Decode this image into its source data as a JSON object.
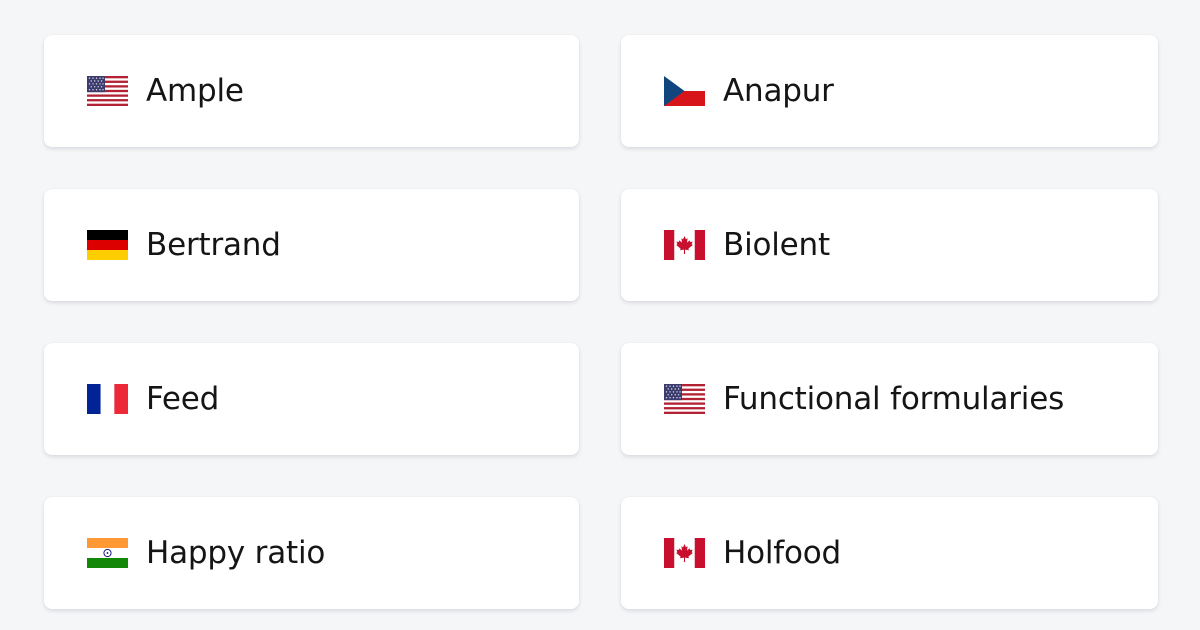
{
  "items": [
    {
      "label": "Ample",
      "flag": "us-flag-icon"
    },
    {
      "label": "Anapur",
      "flag": "czech-flag-icon"
    },
    {
      "label": "Bertrand",
      "flag": "germany-flag-icon"
    },
    {
      "label": "Biolent",
      "flag": "canada-flag-icon"
    },
    {
      "label": "Feed",
      "flag": "france-flag-icon"
    },
    {
      "label": "Functional formularies",
      "flag": "us-flag-icon"
    },
    {
      "label": "Happy ratio",
      "flag": "india-flag-icon"
    },
    {
      "label": "Holfood",
      "flag": "canada-flag-icon"
    }
  ],
  "colors": {
    "background": "#f5f6f8",
    "card": "#ffffff",
    "text": "#151515"
  }
}
